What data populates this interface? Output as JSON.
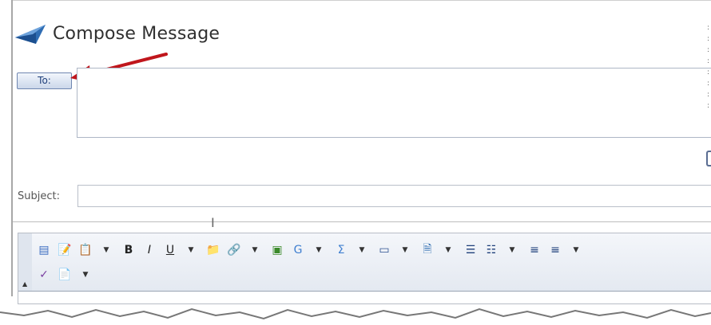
{
  "header": {
    "title": "Compose Message",
    "icon": "message-plane-icon"
  },
  "to_button": {
    "label": "To:"
  },
  "subject": {
    "label": "Subject:",
    "value": ""
  },
  "toolbar": {
    "row1": [
      {
        "name": "source-icon",
        "glyph": "▤",
        "color": "#3a6bc0"
      },
      {
        "name": "paste-text-icon",
        "glyph": "📝",
        "color": "#6b8ec9"
      },
      {
        "name": "paste-word-icon",
        "glyph": "📋",
        "color": "#3b6fb0",
        "dropdown": true
      },
      {
        "name": "bold-icon",
        "glyph": "B",
        "color": "#222"
      },
      {
        "name": "italic-icon",
        "glyph": "I",
        "color": "#222"
      },
      {
        "name": "underline-icon",
        "glyph": "U",
        "color": "#222",
        "dropdown": true
      },
      {
        "name": "folder-icon",
        "glyph": "📁",
        "color": "#d6a800"
      },
      {
        "name": "link-icon",
        "glyph": "🔗",
        "color": "#4a7fa8",
        "dropdown": true
      },
      {
        "name": "image-icon",
        "glyph": "▣",
        "color": "#3b8a2a"
      },
      {
        "name": "special-char-icon",
        "glyph": "G",
        "color": "#3f7fd0",
        "dropdown": true
      },
      {
        "name": "sigma-icon",
        "glyph": "Σ",
        "color": "#3f7fd0",
        "dropdown": true
      },
      {
        "name": "table-icon",
        "glyph": "▭",
        "color": "#2a4f8f",
        "dropdown": true
      },
      {
        "name": "document-icon",
        "glyph": "🗎",
        "color": "#2a6ab0",
        "dropdown": true
      },
      {
        "name": "numbered-list-icon",
        "glyph": "☰",
        "color": "#1e3f7a"
      },
      {
        "name": "bullet-list-icon",
        "glyph": "☷",
        "color": "#1e3f7a",
        "dropdown": true
      },
      {
        "name": "align-left-icon",
        "glyph": "≡",
        "color": "#1e3f7a"
      },
      {
        "name": "align-center-icon",
        "glyph": "≡",
        "color": "#1e3f7a",
        "dropdown": true
      }
    ],
    "row2": [
      {
        "name": "spellcheck-icon",
        "glyph": "✓",
        "color": "#7a3fa0"
      },
      {
        "name": "paste-plain-icon",
        "glyph": "📄",
        "color": "#6b8ec9",
        "dropdown": true
      }
    ],
    "collapse_glyph": "▲"
  }
}
